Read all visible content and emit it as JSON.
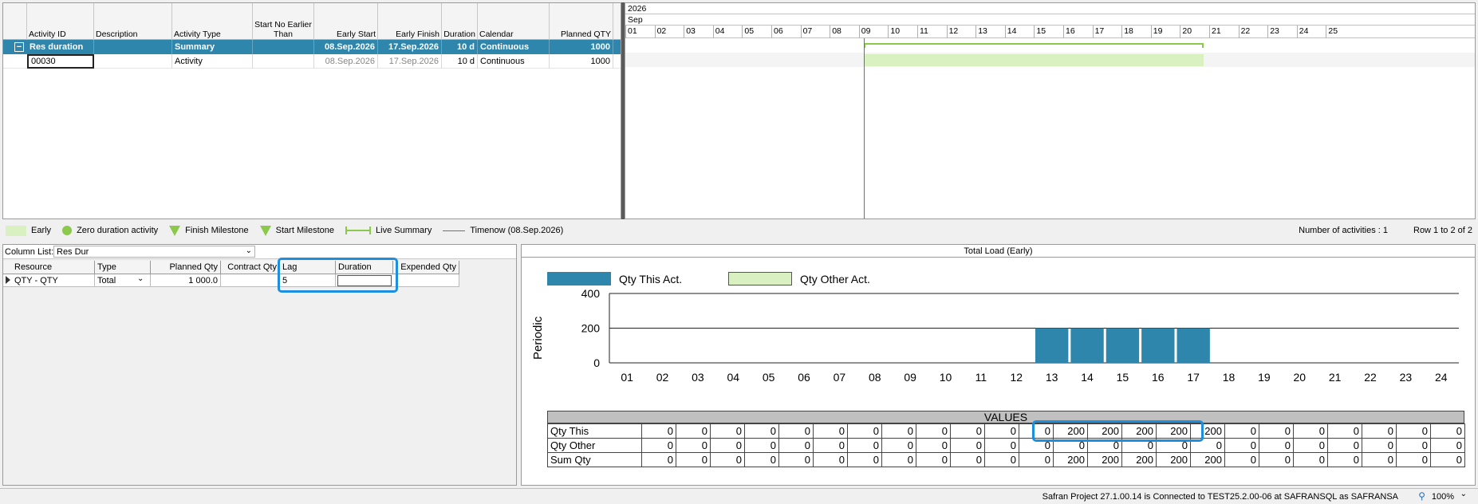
{
  "activity_table": {
    "headers": [
      "Activity ID",
      "Description",
      "Activity Type",
      "Start No Earlier Than",
      "Early Start",
      "Early Finish",
      "Duration",
      "Calendar",
      "Planned QTY"
    ],
    "rows": [
      {
        "id": "Res duration",
        "desc": "",
        "type": "Summary",
        "snet": "",
        "es": "08.Sep.2026",
        "ef": "17.Sep.2026",
        "dur": "10 d",
        "cal": "Continuous",
        "qty": "1000"
      },
      {
        "id": "00030",
        "desc": "",
        "type": "Activity",
        "snet": "",
        "es": "08.Sep.2026",
        "ef": "17.Sep.2026",
        "dur": "10 d",
        "cal": "Continuous",
        "qty": "1000"
      }
    ],
    "expand_symbol": "−"
  },
  "gantt": {
    "year": "2026",
    "month": "Sep",
    "days": [
      "01",
      "02",
      "03",
      "04",
      "05",
      "06",
      "07",
      "08",
      "09",
      "10",
      "11",
      "12",
      "13",
      "14",
      "15",
      "16",
      "17",
      "18",
      "19",
      "20",
      "21",
      "22",
      "23",
      "24",
      "25"
    ]
  },
  "legend": {
    "early": "Early",
    "zero_duration": "Zero duration activity",
    "finish_milestone": "Finish Milestone",
    "start_milestone": "Start Milestone",
    "live_summary": "Live Summary",
    "timenow": "Timenow (08.Sep.2026)",
    "activity_count": "Number of activities : 1",
    "row_info": "Row 1 to 2 of 2"
  },
  "resource_panel": {
    "column_list_label": "Column List:",
    "column_list_value": "Res Dur",
    "headers": [
      "Resource",
      "Type",
      "Planned Qty",
      "Contract Qty",
      "Lag",
      "Duration",
      "Expended Qty"
    ],
    "row": {
      "resource": "QTY - QTY",
      "type": "Total",
      "planned": "1 000.0",
      "contract": "",
      "lag": "5",
      "duration": "",
      "expended": ""
    }
  },
  "load_chart": {
    "title": "Total Load (Early)",
    "legend_this": "Qty This Act.",
    "legend_other": "Qty Other Act.",
    "ylabel": "Periodic",
    "values_header": "VALUES",
    "row_labels": [
      "Qty This",
      "Qty Other",
      "Sum Qty"
    ],
    "colors": {
      "this": "#2e86ad",
      "other": "#d9f0c0"
    }
  },
  "chart_data": {
    "type": "bar",
    "categories": [
      "01",
      "02",
      "03",
      "04",
      "05",
      "06",
      "07",
      "08",
      "09",
      "10",
      "11",
      "12",
      "13",
      "14",
      "15",
      "16",
      "17",
      "18",
      "19",
      "20",
      "21",
      "22",
      "23",
      "24"
    ],
    "series": [
      {
        "name": "Qty This Act.",
        "values": [
          0,
          0,
          0,
          0,
          0,
          0,
          0,
          0,
          0,
          0,
          0,
          0,
          200,
          200,
          200,
          200,
          200,
          0,
          0,
          0,
          0,
          0,
          0,
          0
        ]
      },
      {
        "name": "Qty Other Act.",
        "values": [
          0,
          0,
          0,
          0,
          0,
          0,
          0,
          0,
          0,
          0,
          0,
          0,
          0,
          0,
          0,
          0,
          0,
          0,
          0,
          0,
          0,
          0,
          0,
          0
        ]
      }
    ],
    "sum": [
      0,
      0,
      0,
      0,
      0,
      0,
      0,
      0,
      0,
      0,
      0,
      0,
      200,
      200,
      200,
      200,
      200,
      0,
      0,
      0,
      0,
      0,
      0,
      0
    ],
    "ylabel": "Periodic",
    "yticks": [
      "0",
      "200",
      "400"
    ],
    "ylim": [
      0,
      400
    ]
  },
  "status_bar": {
    "text": "Safran Project 27.1.00.14 is Connected to TEST25.2.00-06 at SAFRANSQL as SAFRANSA",
    "zoom": "100%"
  }
}
